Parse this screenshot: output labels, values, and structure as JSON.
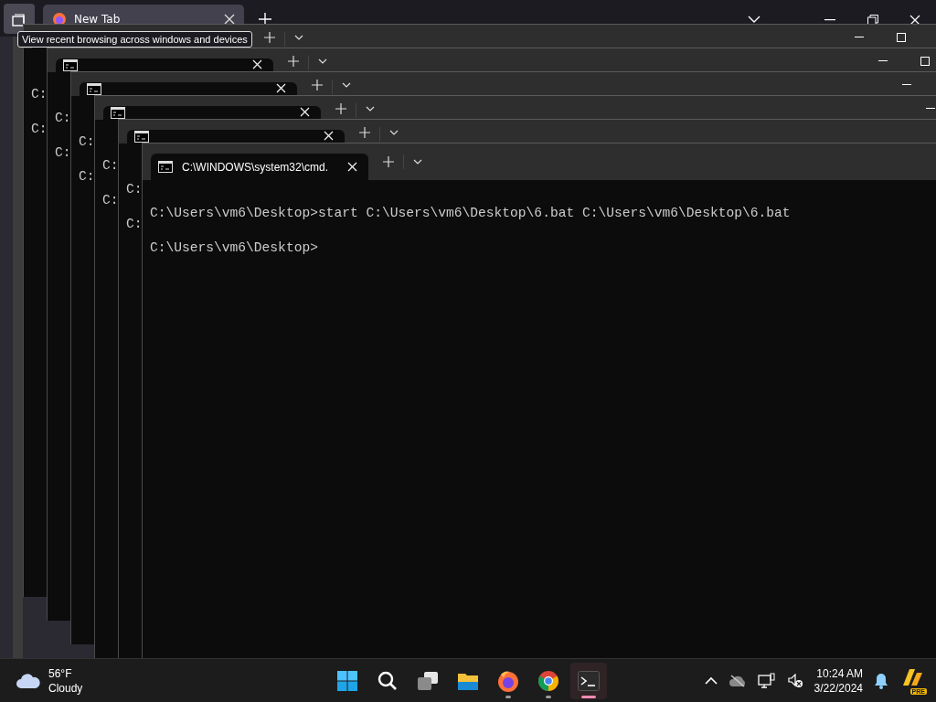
{
  "browser": {
    "tab": {
      "title": "New Tab"
    },
    "tooltip": "View recent browsing across windows and devices"
  },
  "windows": [
    {
      "lines": [
        "C:",
        "C:"
      ]
    },
    {
      "lines": [
        "C:",
        "C:"
      ]
    },
    {
      "lines": [
        "C:",
        "C:"
      ]
    },
    {
      "lines": [
        "C:",
        "C:"
      ]
    },
    {
      "lines": [
        "C:",
        "C:"
      ]
    },
    {
      "title": "C:\\WINDOWS\\system32\\cmd.",
      "lines": [
        "C:\\Users\\vm6\\Desktop>start C:\\Users\\vm6\\Desktop\\6.bat C:\\Users\\vm6\\Desktop\\6.bat",
        "C:\\Users\\vm6\\Desktop>"
      ]
    }
  ],
  "taskbar": {
    "weather": {
      "temp": "56°F",
      "condition": "Cloudy"
    },
    "apps": [
      {
        "kind": "start",
        "running": false,
        "active": false
      },
      {
        "kind": "search",
        "running": false,
        "active": false
      },
      {
        "kind": "taskview",
        "running": false,
        "active": false
      },
      {
        "kind": "files",
        "running": false,
        "active": false
      },
      {
        "kind": "fox",
        "running": true,
        "active": false
      },
      {
        "kind": "chrome",
        "running": true,
        "active": false
      },
      {
        "kind": "terminal",
        "running": true,
        "active": true
      }
    ],
    "clock": {
      "time": "10:24 AM",
      "date": "3/22/2024"
    },
    "badge": "PRE"
  }
}
